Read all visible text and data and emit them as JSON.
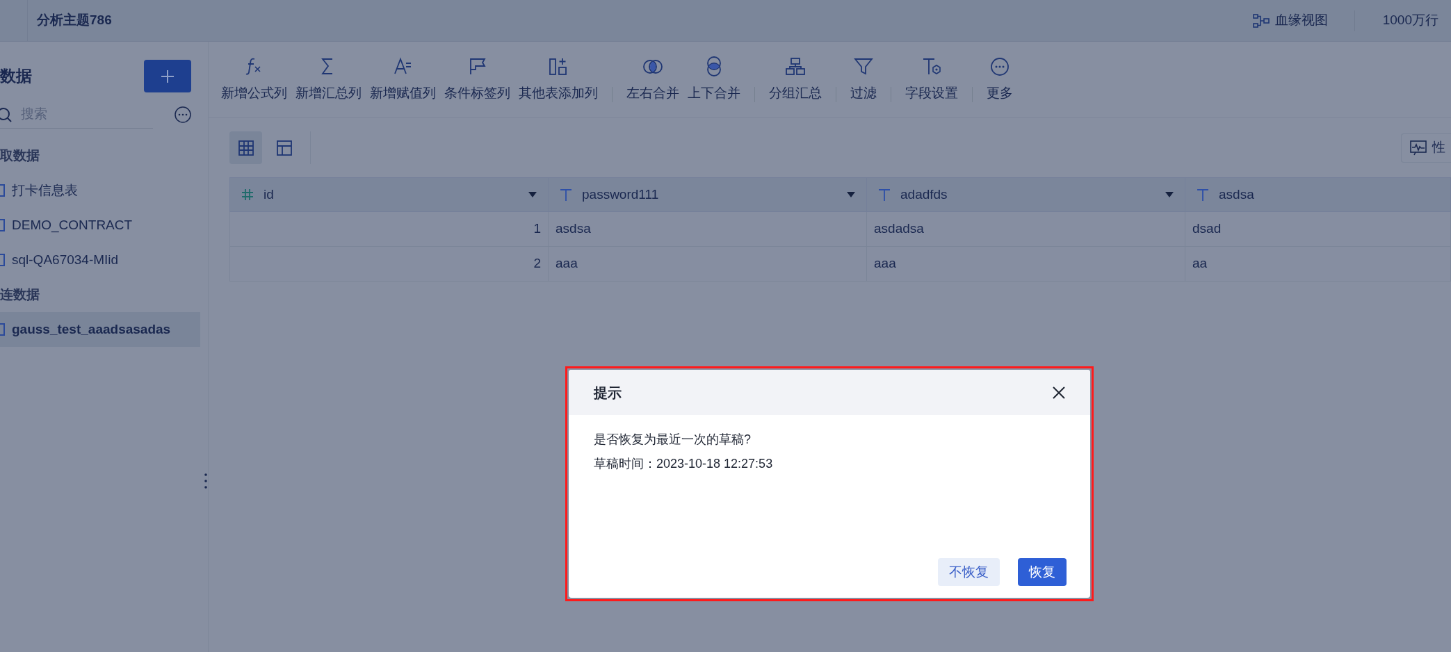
{
  "header": {
    "title": "分析主题786",
    "lineage_link": "血缘视图",
    "row_count": "1000万行"
  },
  "sidebar": {
    "heading": "数据",
    "search": {
      "placeholder": "搜索"
    },
    "groups": [
      {
        "label": "取数据",
        "items": [
          {
            "label": "打卡信息表",
            "selected": false
          },
          {
            "label": "DEMO_CONTRACT",
            "selected": false
          },
          {
            "label": "sql-QA67034-MIid",
            "selected": false
          }
        ]
      },
      {
        "label": "连数据",
        "items": [
          {
            "label": "gauss_test_aaadsasadas",
            "selected": true
          }
        ]
      }
    ]
  },
  "toolbar": {
    "groups": [
      [
        {
          "label": "新增公式列",
          "kind": "formula"
        },
        {
          "label": "新增汇总列",
          "kind": "sum"
        },
        {
          "label": "新增赋值列",
          "kind": "assign"
        },
        {
          "label": "条件标签列",
          "kind": "flag"
        },
        {
          "label": "其他表添加列",
          "kind": "addcol"
        }
      ],
      [
        {
          "label": "左右合并",
          "kind": "hmerge"
        },
        {
          "label": "上下合并",
          "kind": "vmerge"
        }
      ],
      [
        {
          "label": "分组汇总",
          "kind": "group"
        }
      ],
      [
        {
          "label": "过滤",
          "kind": "filter"
        }
      ],
      [
        {
          "label": "字段设置",
          "kind": "field"
        }
      ],
      [
        {
          "label": "更多",
          "kind": "more"
        }
      ]
    ]
  },
  "view_toggles": [
    {
      "kind": "grid",
      "selected": true
    },
    {
      "kind": "layout",
      "selected": false
    }
  ],
  "performance_button": {
    "label": "性"
  },
  "table": {
    "columns": [
      {
        "name": "id",
        "kind": "number",
        "dropdown": true
      },
      {
        "name": "password111",
        "kind": "text",
        "dropdown": true
      },
      {
        "name": "adadfds",
        "kind": "text",
        "dropdown": true
      },
      {
        "name": "asdsa",
        "kind": "text",
        "dropdown": false
      }
    ],
    "rows": [
      [
        "1",
        "asdsa",
        "asdadsa",
        "dsad"
      ],
      [
        "2",
        "aaa",
        "aaa",
        "aa"
      ]
    ]
  },
  "dialog": {
    "title": "提示",
    "message": [
      "是否恢复为最近一次的草稿?",
      "草稿时间：2023-10-18 12:27:53"
    ],
    "buttons": [
      {
        "label": "不恢复",
        "kind": "secondary"
      },
      {
        "label": "恢复",
        "kind": "primary"
      }
    ]
  }
}
